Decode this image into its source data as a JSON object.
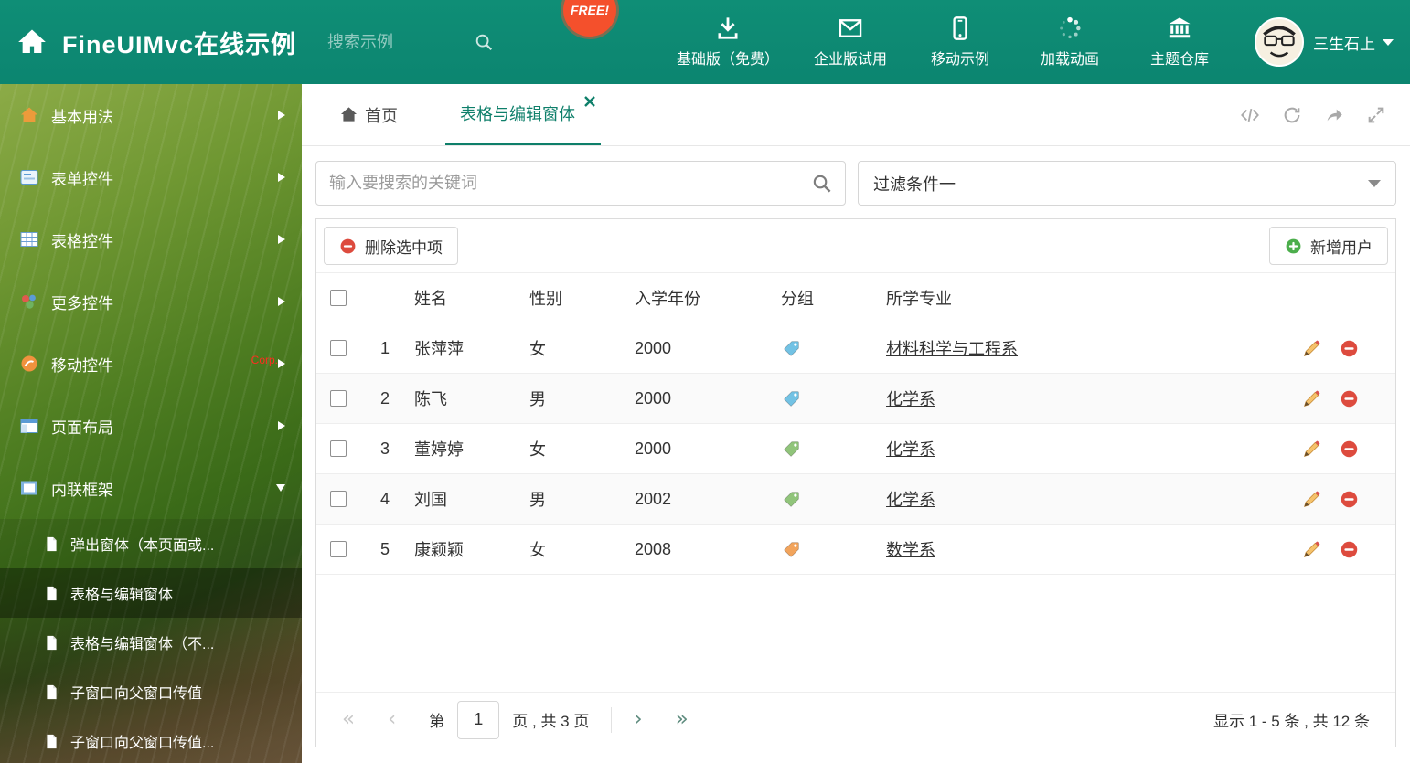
{
  "header": {
    "title": "FineUIMvc在线示例",
    "search_placeholder": "搜索示例",
    "free_badge": "FREE!",
    "nav": [
      {
        "label": "基础版（免费）",
        "icon": "download-icon"
      },
      {
        "label": "企业版试用",
        "icon": "envelope-icon"
      },
      {
        "label": "移动示例",
        "icon": "mobile-icon"
      },
      {
        "label": "加载动画",
        "icon": "spinner-icon"
      },
      {
        "label": "主题仓库",
        "icon": "bank-icon"
      }
    ],
    "user_name": "三生石上"
  },
  "sidebar": {
    "items": [
      {
        "label": "基本用法"
      },
      {
        "label": "表单控件"
      },
      {
        "label": "表格控件"
      },
      {
        "label": "更多控件"
      },
      {
        "label": "移动控件",
        "badge": "Corp."
      },
      {
        "label": "页面布局"
      },
      {
        "label": "内联框架"
      }
    ],
    "subitems": [
      {
        "label": "弹出窗体（本页面或..."
      },
      {
        "label": "表格与编辑窗体"
      },
      {
        "label": "表格与编辑窗体（不..."
      },
      {
        "label": "子窗口向父窗口传值"
      },
      {
        "label": "子窗口向父窗口传值..."
      }
    ]
  },
  "tabs": {
    "home": "首页",
    "active": "表格与编辑窗体",
    "close_icon": "✕"
  },
  "search": {
    "placeholder": "输入要搜索的关键词",
    "filter_value": "过滤条件一"
  },
  "toolbar": {
    "delete_label": "删除选中项",
    "add_label": "新增用户"
  },
  "table": {
    "columns": {
      "name": "姓名",
      "gender": "性别",
      "year": "入学年份",
      "group": "分组",
      "major": "所学专业"
    },
    "rows": [
      {
        "num": "1",
        "name": "张萍萍",
        "gender": "女",
        "year": "2000",
        "tag_color": "#72c2e4",
        "major": "材料科学与工程系"
      },
      {
        "num": "2",
        "name": "陈飞",
        "gender": "男",
        "year": "2000",
        "tag_color": "#72c2e4",
        "major": "化学系"
      },
      {
        "num": "3",
        "name": "董婷婷",
        "gender": "女",
        "year": "2000",
        "tag_color": "#90c47a",
        "major": "化学系"
      },
      {
        "num": "4",
        "name": "刘国",
        "gender": "男",
        "year": "2002",
        "tag_color": "#90c47a",
        "major": "化学系"
      },
      {
        "num": "5",
        "name": "康颖颖",
        "gender": "女",
        "year": "2008",
        "tag_color": "#f2a45c",
        "major": "数学系"
      }
    ]
  },
  "pagination": {
    "first": "«",
    "prev": "‹",
    "page_prefix": "第",
    "page_value": "1",
    "page_suffix": "页 , 共 3 页",
    "next": "›",
    "last": "»",
    "summary": "显示 1 - 5 条 , 共 12 条"
  },
  "colors": {
    "header_bg": "#0d8a72",
    "accent_teal": "#0e7f6a",
    "delete_red": "#dd4b3e",
    "add_green": "#4cae4c",
    "free_orange": "#f4502c"
  }
}
